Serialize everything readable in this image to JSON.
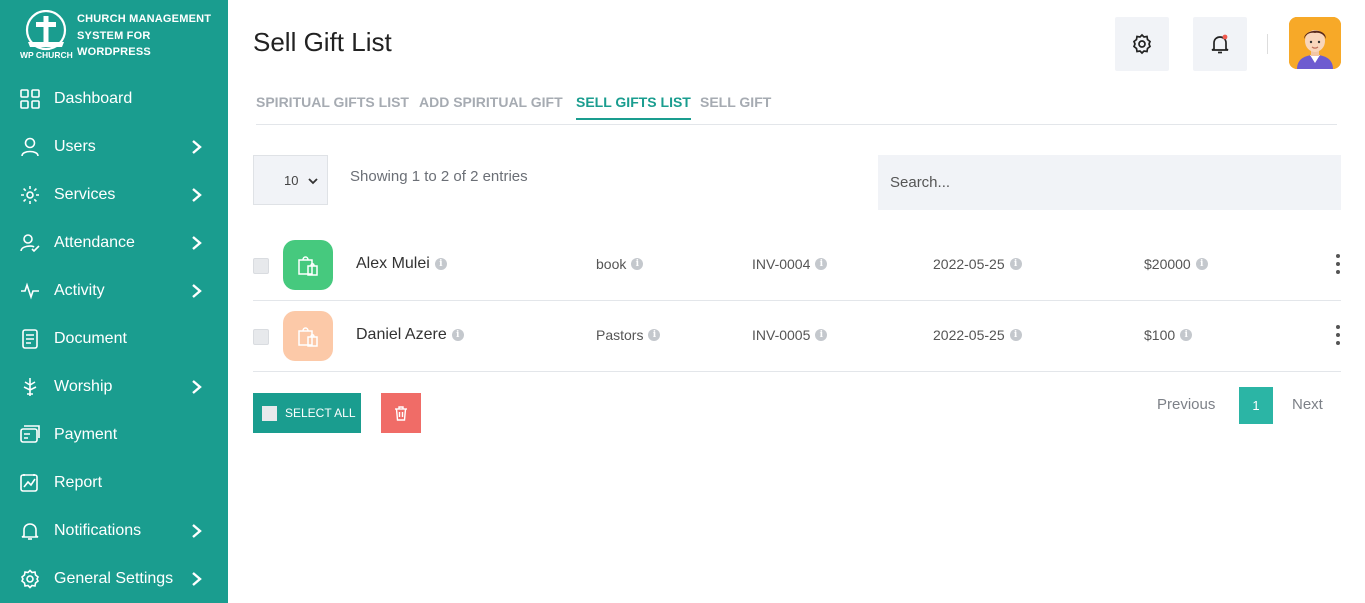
{
  "app": {
    "logo_text": "CHURCH MANAGEMENT SYSTEM FOR WORDPRESS",
    "logo_caption": "WP CHURCH",
    "accent_color": "#1a9d8f"
  },
  "sidebar": {
    "items": [
      {
        "label": "Dashboard",
        "icon": "grid-icon",
        "has_submenu": false
      },
      {
        "label": "Users",
        "icon": "user-icon",
        "has_submenu": true
      },
      {
        "label": "Services",
        "icon": "services-gear-icon",
        "has_submenu": true
      },
      {
        "label": "Attendance",
        "icon": "user-check-icon",
        "has_submenu": true
      },
      {
        "label": "Activity",
        "icon": "activity-pulse-icon",
        "has_submenu": true
      },
      {
        "label": "Document",
        "icon": "document-icon",
        "has_submenu": false
      },
      {
        "label": "Worship",
        "icon": "worship-icon",
        "has_submenu": true
      },
      {
        "label": "Payment",
        "icon": "payment-card-icon",
        "has_submenu": false
      },
      {
        "label": "Report",
        "icon": "report-icon",
        "has_submenu": false
      },
      {
        "label": "Notifications",
        "icon": "bell-icon",
        "has_submenu": true
      },
      {
        "label": "General Settings",
        "icon": "gear-icon",
        "has_submenu": true
      }
    ]
  },
  "header": {
    "title": "Sell Gift List",
    "settings_icon": "gear-icon",
    "notification_icon": "bell-icon",
    "avatar_icon": "user-avatar"
  },
  "tabs": [
    {
      "label": "SPIRITUAL GIFTS LIST",
      "active": false
    },
    {
      "label": "ADD SPIRITUAL GIFT",
      "active": false
    },
    {
      "label": "SELL GIFTS LIST",
      "active": true
    },
    {
      "label": "SELL GIFT",
      "active": false
    }
  ],
  "table_controls": {
    "page_length": "10",
    "info": "Showing 1 to 2 of 2 entries",
    "search_placeholder": "Search..."
  },
  "rows": [
    {
      "name": "Alex Mulei",
      "gift": "book",
      "invoice": "INV-0004",
      "date": "2022-05-25",
      "amount": "$20000",
      "icon_bg": "#46c97e"
    },
    {
      "name": "Daniel Azere",
      "gift": "Pastors",
      "invoice": "INV-0005",
      "date": "2022-05-25",
      "amount": "$100",
      "icon_bg": "#fcc9a8"
    }
  ],
  "footer": {
    "select_all_label": "SELECT ALL",
    "delete_color": "#f06c67",
    "prev_label": "Previous",
    "current_page": "1",
    "next_label": "Next"
  }
}
